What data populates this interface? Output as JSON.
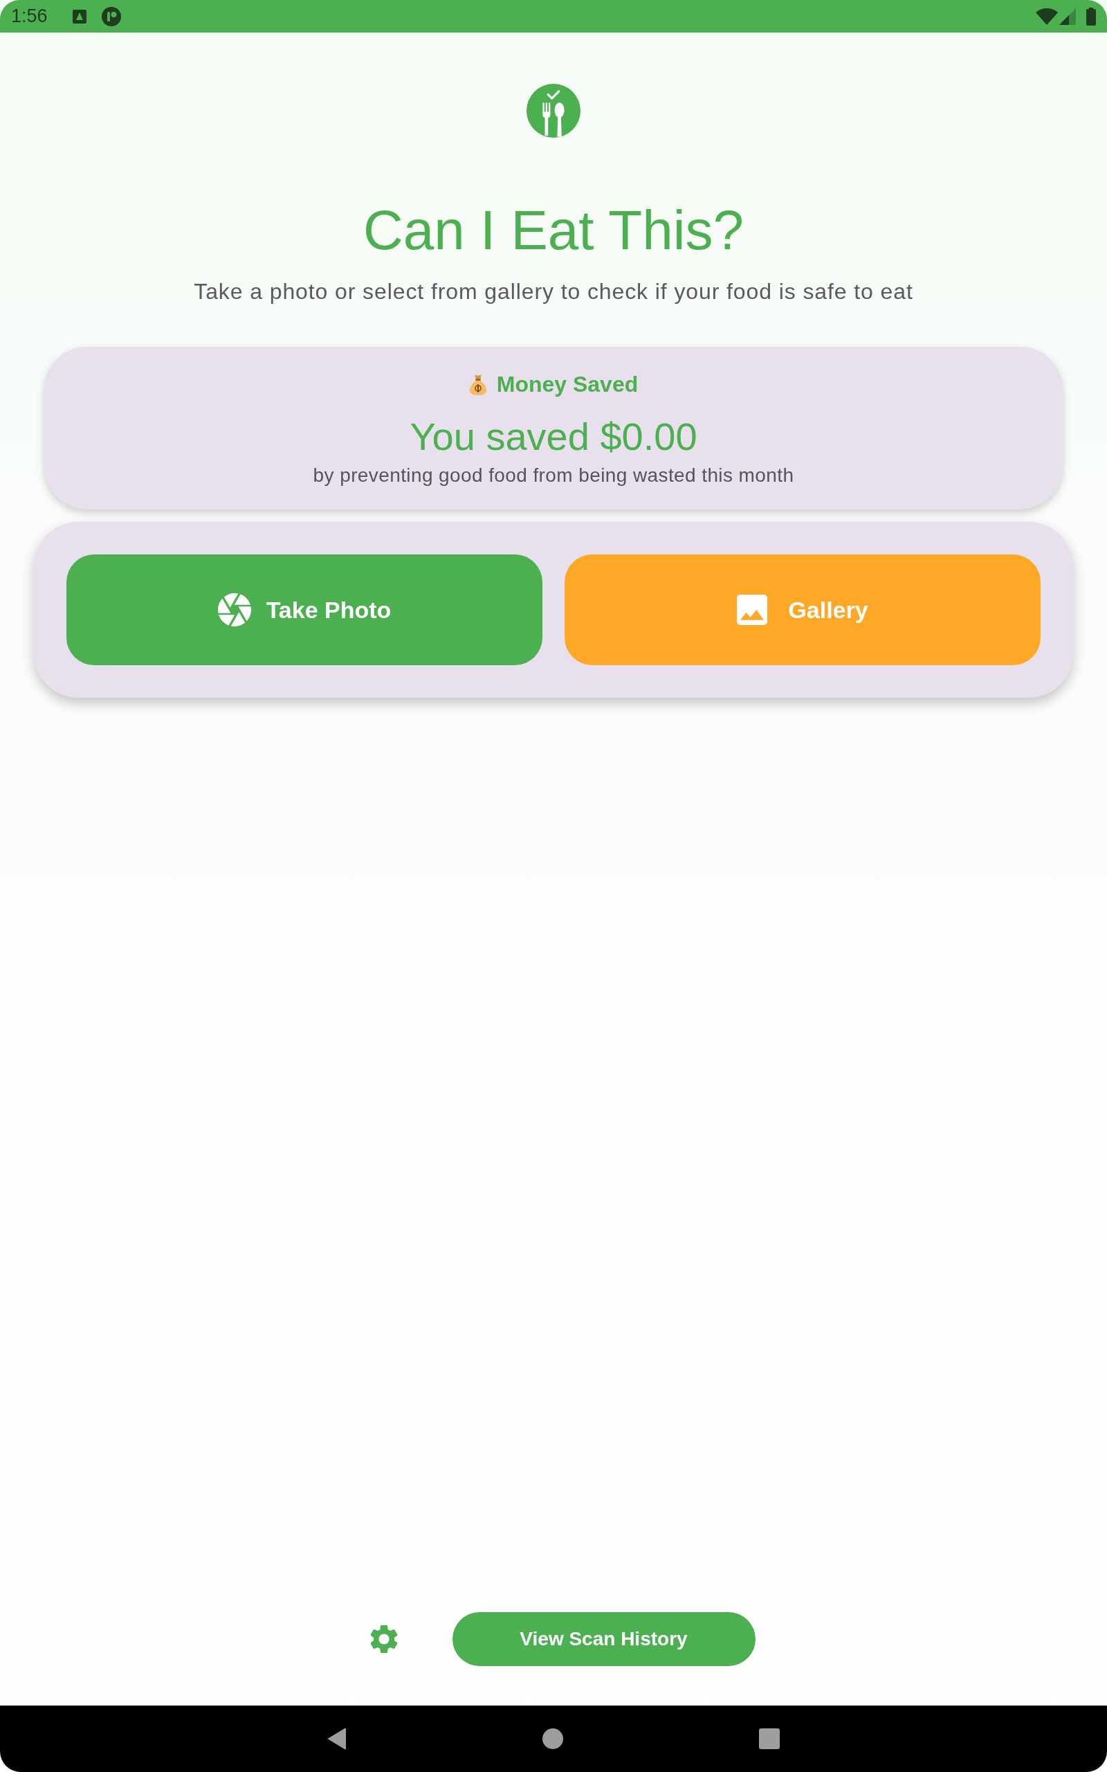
{
  "status_bar": {
    "time": "1:56"
  },
  "header": {
    "title": "Can I Eat This?",
    "subtitle": "Take a photo or select from gallery to check if your food is safe to eat"
  },
  "savings_card": {
    "heading": "Money Saved",
    "amount": "You saved $0.00",
    "caption": "by preventing good food from being wasted this month"
  },
  "actions": [
    {
      "kind": "camera",
      "label": "Take Photo",
      "color": "#4caf50"
    },
    {
      "kind": "gallery",
      "label": "Gallery",
      "color": "#ffa726"
    }
  ],
  "footer": {
    "history_button": "View Scan History"
  }
}
